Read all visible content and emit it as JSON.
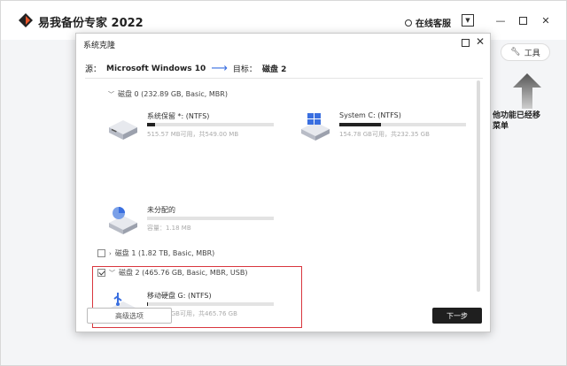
{
  "app": {
    "title": "易我备份专家 2022",
    "service_label": "在线客服",
    "menu_icon": "chevron-down-icon",
    "tools_label": "工具",
    "hint_text": "他功能已经移\n菜单"
  },
  "dialog": {
    "title": "系统克隆",
    "source_label": "源：",
    "source_value": "Microsoft Windows 10",
    "target_label": "目标：",
    "target_value": "磁盘 2",
    "disks": [
      {
        "header": "磁盘 0 (232.89 GB, Basic, MBR)",
        "partitions": [
          {
            "name": "系统保留 *: (NTFS)",
            "size": "515.57 MB可用，共549.00 MB",
            "used_fraction": 0.06
          },
          {
            "name": "System C: (NTFS)",
            "size": "154.78 GB可用，共232.35 GB",
            "used_fraction": 0.33
          },
          {
            "name": "未分配的",
            "size": "容量：1.18 MB",
            "used_fraction": 0
          }
        ]
      },
      {
        "header": "磁盘 1 (1.82 TB, Basic, MBR)",
        "partitions": []
      },
      {
        "header": "磁盘 2 (465.76 GB, Basic, MBR, USB)",
        "checked": true,
        "partitions": [
          {
            "name": "移动硬盘 G: (NTFS)",
            "size": "437.49 GB可用，共465.76 GB",
            "used_fraction": 0.01
          }
        ]
      }
    ],
    "advanced_label": "高级选项",
    "next_label": "下一步"
  },
  "colors": {
    "accent": "#3a6fe0",
    "selection": "#d9363e",
    "primary_button": "#1f1f1f"
  }
}
